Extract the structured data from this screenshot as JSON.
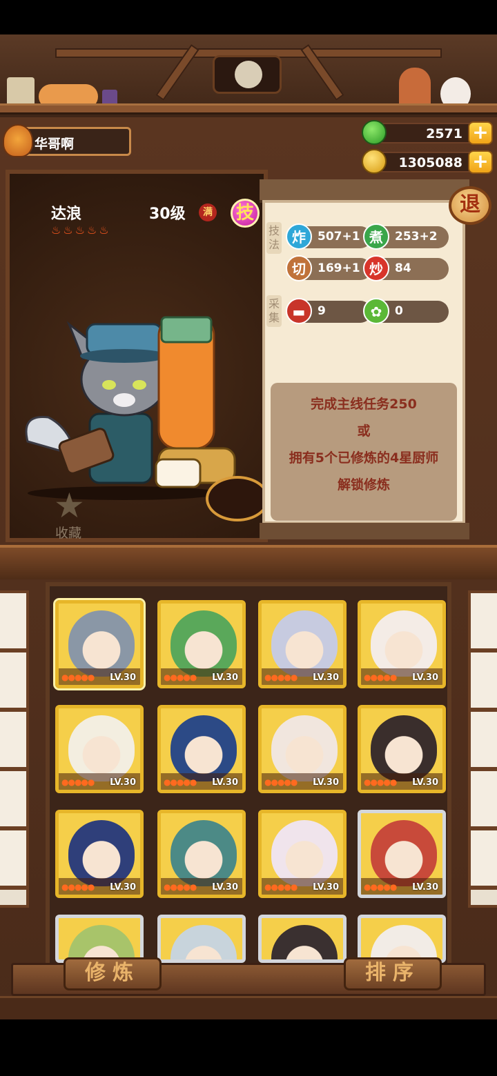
{
  "player": {
    "name": "华哥啊",
    "avatar_icon": "fox-avatar-icon"
  },
  "currencies": [
    {
      "name": "jade",
      "icon": "jade-coin-icon",
      "value": "2571",
      "color": "#3fbf3a"
    },
    {
      "name": "gold",
      "icon": "gold-coin-icon",
      "value": "1305088",
      "color": "#f1b91f"
    }
  ],
  "chef": {
    "name": "达浪",
    "level": "30级",
    "max_badge": "满",
    "skill_badge": "技",
    "stars": 5,
    "favorite_label": "收藏"
  },
  "stats": {
    "technique_label": "技法",
    "gather_label": "采集",
    "technique": [
      {
        "glyph": "炸",
        "value": "507+1",
        "color": "#2ea7d8"
      },
      {
        "glyph": "煮",
        "value": "253+2",
        "color": "#3aa64a"
      },
      {
        "glyph": "切",
        "value": "169+1",
        "color": "#c0723a"
      },
      {
        "glyph": "炒",
        "value": "84",
        "color": "#d8352b"
      }
    ],
    "gather": [
      {
        "icon": "meat-icon",
        "value": "9",
        "color": "#c8352a"
      },
      {
        "icon": "vegetable-icon",
        "value": "0",
        "color": "#5bb837"
      }
    ]
  },
  "unlock_text": [
    "完成主线任务250",
    "或",
    "拥有5个已修炼的4星厨师",
    "解锁修炼"
  ],
  "exit_label": "退",
  "cards": [
    {
      "lv": "LV.30",
      "frame": "gold",
      "selected": true,
      "color": "#8a97a6"
    },
    {
      "lv": "LV.30",
      "frame": "gold",
      "color": "#5aa85a"
    },
    {
      "lv": "LV.30",
      "frame": "gold",
      "color": "#c7cbe0"
    },
    {
      "lv": "LV.30",
      "frame": "gold",
      "color": "#f4ece6"
    },
    {
      "lv": "LV.30",
      "frame": "gold",
      "color": "#f3eee0"
    },
    {
      "lv": "LV.30",
      "frame": "gold",
      "color": "#2c4a86"
    },
    {
      "lv": "LV.30",
      "frame": "gold",
      "color": "#f1e6de"
    },
    {
      "lv": "LV.30",
      "frame": "gold",
      "color": "#3a2e2c"
    },
    {
      "lv": "LV.30",
      "frame": "gold",
      "color": "#2f3f7a"
    },
    {
      "lv": "LV.30",
      "frame": "gold",
      "color": "#4c8a86"
    },
    {
      "lv": "LV.30",
      "frame": "gold",
      "color": "#f0e4ec"
    },
    {
      "lv": "LV.30",
      "frame": "silver",
      "color": "#c84a3a"
    },
    {
      "lv": "",
      "frame": "silver",
      "color": "#a8c46a"
    },
    {
      "lv": "",
      "frame": "silver",
      "color": "#c8d4dc"
    },
    {
      "lv": "",
      "frame": "silver",
      "color": "#3a3030"
    },
    {
      "lv": "",
      "frame": "silver",
      "color": "#f2ece6"
    }
  ],
  "buttons": {
    "cultivate": "修炼",
    "sort": "排序"
  }
}
